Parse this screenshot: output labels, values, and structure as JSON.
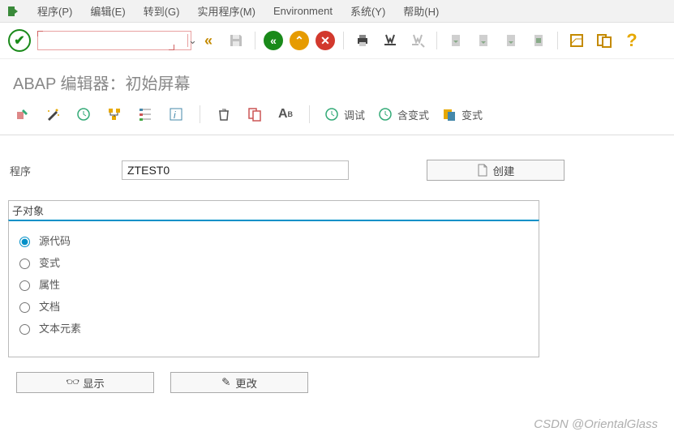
{
  "menu": {
    "items": [
      "程序(P)",
      "编辑(E)",
      "转到(G)",
      "实用程序(M)",
      "Environment",
      "系统(Y)",
      "帮助(H)"
    ]
  },
  "command_field": {
    "value": ""
  },
  "title": "ABAP 编辑器：初始屏幕",
  "tb2": {
    "debug": "调试",
    "with_var": "含变式",
    "variant": "变式"
  },
  "form": {
    "program_label": "程序",
    "program_value": "ZTEST0",
    "create_label": "创建"
  },
  "subobj": {
    "legend": "子对象",
    "options": [
      "源代码",
      "变式",
      "属性",
      "文档",
      "文本元素"
    ],
    "selected": 0
  },
  "actions": {
    "display": "显示",
    "change": "更改"
  },
  "watermark": "CSDN @OrientalGlass"
}
